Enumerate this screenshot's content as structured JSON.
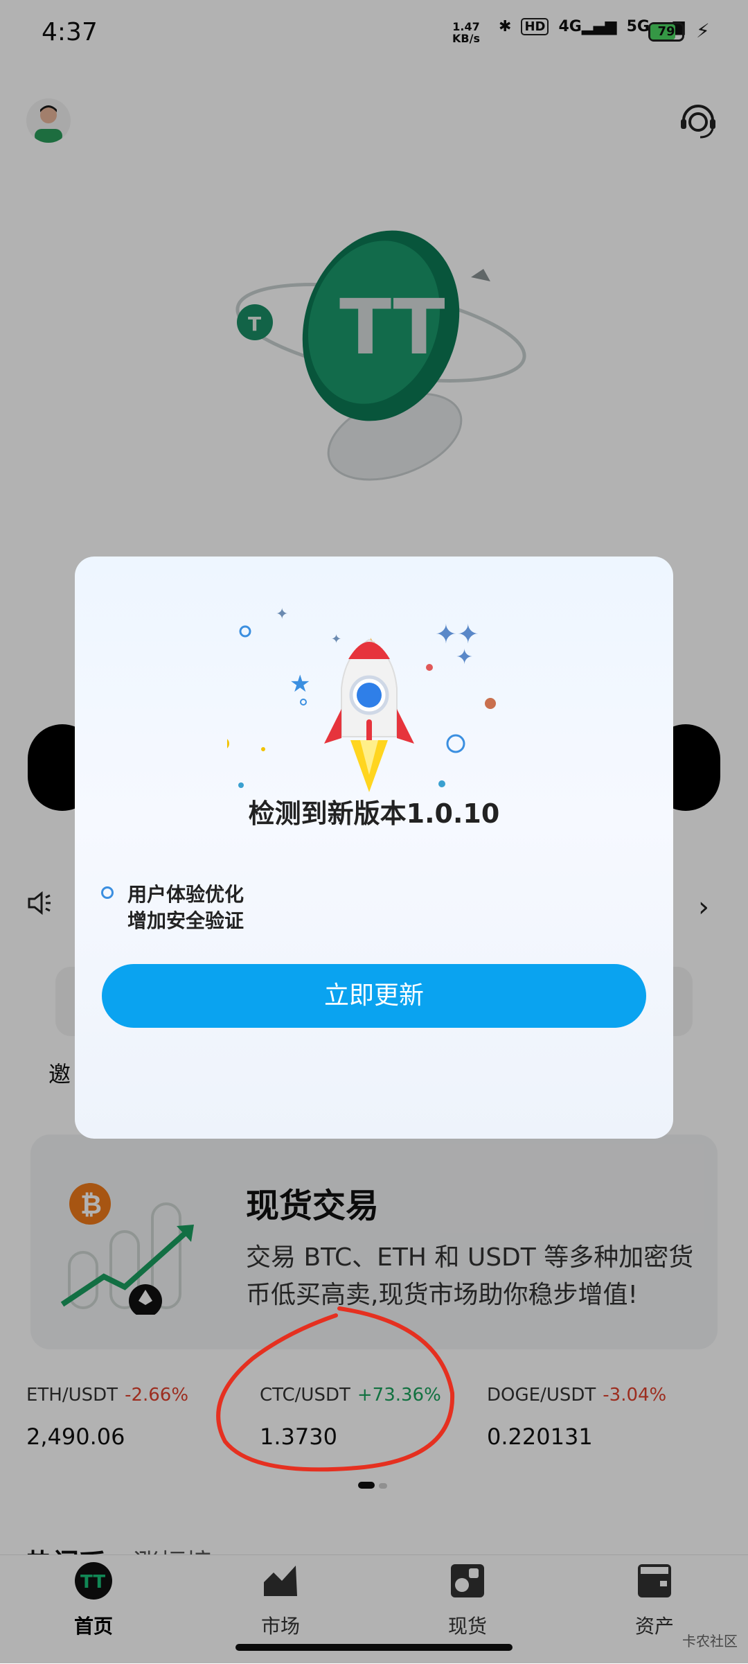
{
  "status_bar": {
    "time": "4:37",
    "net_speed_value": "1.47",
    "net_speed_unit": "KB/s",
    "hd": "HD",
    "sig1": "4G",
    "sig2": "5G",
    "battery": "79"
  },
  "hero": {
    "logo_text": "TT"
  },
  "dialog": {
    "title": "检测到新版本1.0.10",
    "features": [
      "用户体验优化",
      "增加安全验证"
    ],
    "button": "立即更新"
  },
  "background": {
    "invite_partial": "邀",
    "spot_title": "现货交易",
    "spot_desc": "交易 BTC、ETH 和 USDT 等多种加密货币低买高卖,现货市场助你稳步增值!",
    "hot_tabs": [
      "热门币",
      "涨幅榜"
    ]
  },
  "tickers": [
    {
      "pair": "ETH/USDT",
      "change": "-2.66%",
      "price": "2,490.06"
    },
    {
      "pair": "CTC/USDT",
      "change": "+73.36%",
      "price": "1.3730"
    },
    {
      "pair": "DOGE/USDT",
      "change": "-3.04%",
      "price": "0.220131"
    }
  ],
  "nav": [
    {
      "label": "首页",
      "icon": "home-logo-icon",
      "active": true
    },
    {
      "label": "市场",
      "icon": "market-chart-icon",
      "active": false
    },
    {
      "label": "现货",
      "icon": "spot-icon",
      "active": false
    },
    {
      "label": "资产",
      "icon": "wallet-icon",
      "active": false
    }
  ],
  "watermark": "卡农社区",
  "colors": {
    "button_blue": "#0aa3f0",
    "positive": "#19a35c",
    "negative": "#e0412d",
    "annotation_red": "#e53020"
  }
}
